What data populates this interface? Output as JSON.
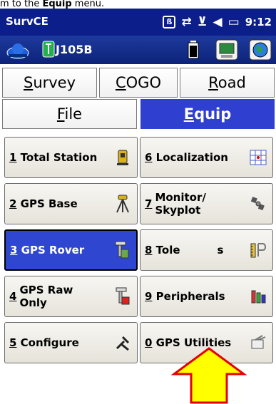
{
  "caption": {
    "prefix": "m to the ",
    "bold": "Equip",
    "suffix": " menu."
  },
  "statusbar": {
    "app_name": "SurvCE",
    "time": "9:12"
  },
  "toolbar": {
    "job_name": "J105B"
  },
  "menubar": {
    "tabs": [
      {
        "label": "Survey",
        "mnemonic": "S",
        "rest": "urvey",
        "active": false
      },
      {
        "label": "COGO",
        "mnemonic": "C",
        "rest": "OGO",
        "active": false
      },
      {
        "label": "Road",
        "mnemonic": "R",
        "rest": "oad",
        "active": false
      },
      {
        "label": "File",
        "mnemonic": "F",
        "rest": "ile",
        "active": false
      },
      {
        "label": "Equip",
        "mnemonic": "E",
        "rest": "quip",
        "active": true
      }
    ]
  },
  "buttons": [
    {
      "num": "1",
      "label": "Total Station",
      "icon": "total-station-icon"
    },
    {
      "num": "6",
      "label": "Localization",
      "icon": "localization-grid-icon"
    },
    {
      "num": "2",
      "label": "GPS Base",
      "icon": "gps-base-tripod-icon"
    },
    {
      "num": "7",
      "line1": "Monitor/",
      "line2": "Skyplot",
      "icon": "satellite-icon"
    },
    {
      "num": "3",
      "label": "GPS Rover",
      "icon": "gps-rover-icon",
      "selected": true
    },
    {
      "num": "8",
      "label": "Tole",
      "label_hidden_tail": "s",
      "icon": "tolerance-ruler-icon"
    },
    {
      "num": "4",
      "line1": "GPS Raw",
      "line2": "Only",
      "icon": "gps-raw-receiver-icon"
    },
    {
      "num": "9",
      "label": "Peripherals",
      "icon": "peripherals-icon"
    },
    {
      "num": "5",
      "label": "Configure",
      "icon": "configure-tools-icon"
    },
    {
      "num": "0",
      "label": "GPS Utilities",
      "icon": "gps-utilities-icon"
    }
  ],
  "overlay": {
    "annotation": "arrow-up-highlight",
    "color": "#ffff00",
    "stroke": "#e60000"
  }
}
